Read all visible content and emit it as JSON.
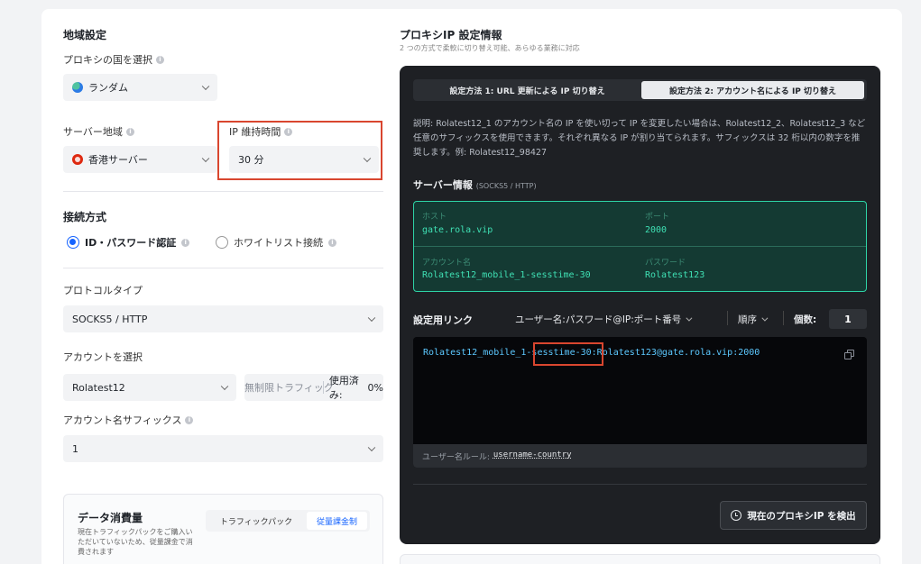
{
  "left": {
    "region_title": "地域設定",
    "country_label": "プロキシの国を選択",
    "country_value": "ランダム",
    "server_region_label": "サーバー地域",
    "server_region_value": "香港サーバー",
    "ip_hold_label": "IP 維持時間",
    "ip_hold_value": "30 分",
    "connection_title": "接続方式",
    "auth_option_id": "ID・パスワード認証",
    "auth_option_whitelist": "ホワイトリスト接続",
    "protocol_label": "プロトコルタイプ",
    "protocol_value": "SOCKS5 / HTTP",
    "account_label": "アカウントを選択",
    "account_value": "Rolatest12",
    "traffic_placeholder": "無制限トラフィック",
    "used_label": "使用済み:",
    "used_value": "0%",
    "suffix_label": "アカウント名サフィックス",
    "suffix_value": "1",
    "data_title": "データ消費量",
    "data_desc": "現在トラフィックパックをご購入いただいていないため、従量課金で消費されます",
    "tab_traffic_pack": "トラフィックパック",
    "tab_metered": "従量課金制"
  },
  "right": {
    "title": "プロキシIP 設定情報",
    "subtitle": "2 つの方式で柔軟に切り替え可能、あらゆる業務に対応",
    "tab1": "設定方法 1: URL 更新による IP 切り替え",
    "tab2": "設定方法 2: アカウント名による IP 切り替え",
    "description": "説明: Rolatest12_1 のアカウント名の IP を使い切って IP を変更したい場合は、Rolatest12_2、Rolatest12_3 など任意のサフィックスを使用できます。それぞれ異なる IP が割り当てられます。サフィックスは 32 桁以内の数字を推奨します。例: Rolatest12_98427",
    "server_info_title": "サーバー情報",
    "server_info_sub": "(SOCKS5 / HTTP)",
    "host_label": "ホスト",
    "host_value": "gate.rola.vip",
    "port_label": "ポート",
    "port_value": "2000",
    "account_label": "アカウント名",
    "account_value": "Rolatest12_mobile_1-sesstime-30",
    "password_label": "パスワード",
    "password_value": "Rolatest123",
    "link_title": "設定用リンク",
    "format_value": "ユーザー名:パスワード@IP:ポート番号",
    "order_value": "順序",
    "count_label": "個数:",
    "count_value": "1",
    "link_part1": "Rolatest12_mobile_1-",
    "link_part2": "sesstime-30",
    "link_part3": ":Rolatest123@gate.rola.vip:2000",
    "rule_label": "ユーザー名ルール:",
    "rule_value": "username-country",
    "detect_button": "現在のプロキシIP を検出"
  },
  "colors": {
    "accent": "#1664ff",
    "teal": "#2ed3a6",
    "highlight": "#d9462f",
    "link": "#5cc8ff"
  }
}
